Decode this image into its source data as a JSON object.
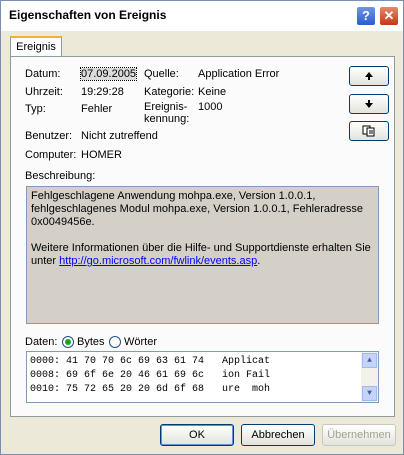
{
  "window": {
    "title": "Eigenschaften von Ereignis"
  },
  "titlebar": {
    "help_glyph": "?",
    "close_glyph": "✕"
  },
  "tabs": [
    {
      "label": "Ereignis"
    }
  ],
  "fields": {
    "datum_label": "Datum:",
    "datum_value": "07.09.2005",
    "uhrzeit_label": "Uhrzeit:",
    "uhrzeit_value": "19:29:28",
    "typ_label": "Typ:",
    "typ_value": "Fehler",
    "benutzer_label": "Benutzer:",
    "benutzer_value": "Nicht zutreffend",
    "computer_label": "Computer:",
    "computer_value": "HOMER",
    "quelle_label": "Quelle:",
    "quelle_value": "Application Error",
    "kategorie_label": "Kategorie:",
    "kategorie_value": "Keine",
    "kennung_label_1": "Ereignis-",
    "kennung_label_2": "kennung:",
    "kennung_value": "1000"
  },
  "side_buttons": {
    "up": "up-arrow-icon",
    "down": "down-arrow-icon",
    "copy": "copy-icon"
  },
  "description": {
    "label": "Beschreibung:",
    "line1": "Fehlgeschlagene Anwendung mohpa.exe, Version 1.0.0.1,",
    "line2": "fehlgeschlagenes Modul mohpa.exe, Version 1.0.0.1, Fehleradresse",
    "line3": "0x0049456e.",
    "line4": "Weitere Informationen über die Hilfe- und Supportdienste erhalten Sie",
    "line5_prefix": "unter ",
    "link": "http://go.microsoft.com/fwlink/events.asp",
    "line5_suffix": "."
  },
  "data_section": {
    "label": "Daten:",
    "radio_bytes": "Bytes",
    "radio_woerter": "Wörter",
    "selected": "Bytes",
    "rows": [
      "0000: 41 70 70 6c 69 63 61 74   Applicat",
      "0008: 69 6f 6e 20 46 61 69 6c   ion Fail",
      "0010: 75 72 65 20 20 6d 6f 68   ure  moh"
    ]
  },
  "buttons": {
    "ok": "OK",
    "cancel": "Abbrechen",
    "apply": "Übernehmen"
  }
}
